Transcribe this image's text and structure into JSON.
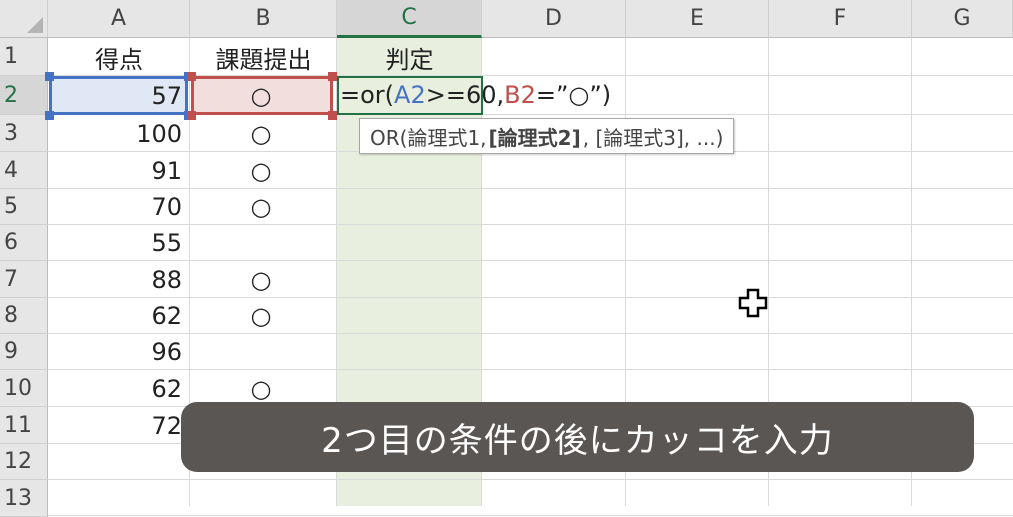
{
  "columns": [
    "A",
    "B",
    "C",
    "D",
    "E",
    "F",
    "G"
  ],
  "rows": [
    "1",
    "2",
    "3",
    "4",
    "5",
    "6",
    "7",
    "8",
    "9",
    "10",
    "11",
    "12",
    "13"
  ],
  "headers": {
    "A1": "得点",
    "B1": "課題提出",
    "C1": "判定"
  },
  "scores": [
    "57",
    "100",
    "91",
    "70",
    "55",
    "88",
    "62",
    "96",
    "62",
    "72"
  ],
  "submitted": [
    "○",
    "○",
    "○",
    "○",
    "",
    "○",
    "○",
    "",
    "○",
    "○"
  ],
  "formula": {
    "p1": "=or(",
    "ref1": "A2",
    "p2": ">=60,",
    "ref2": "B2",
    "p3": "=”○”)"
  },
  "tooltip": {
    "start": "OR(論理式1, ",
    "bold": "[論理式2]",
    "end": ", [論理式3], ...)"
  },
  "caption": "2つ目の条件の後にカッコを入力",
  "colors": {
    "ref1": "#4472c4",
    "ref2": "#c0504d",
    "accent": "#217346"
  }
}
